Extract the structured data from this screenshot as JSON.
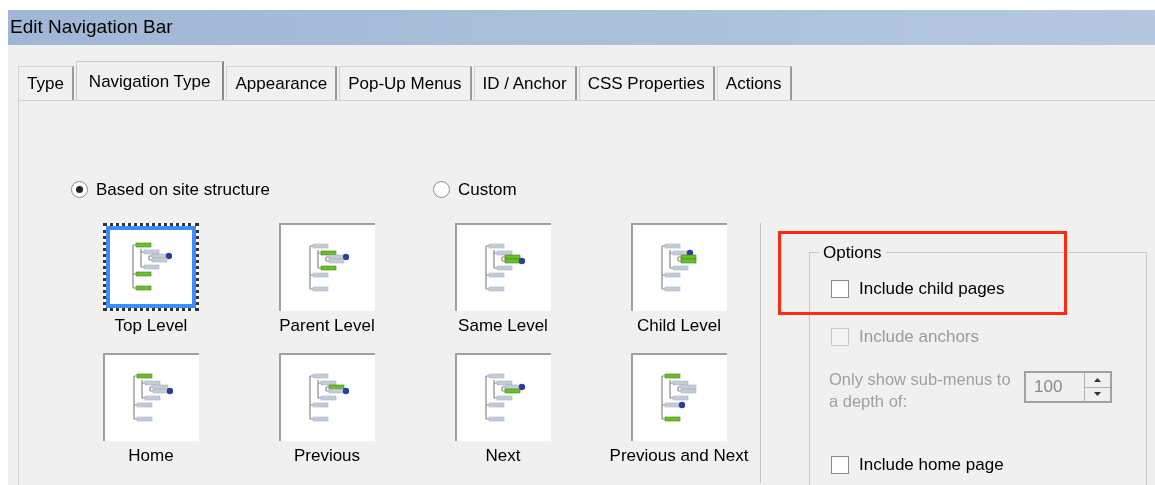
{
  "window": {
    "title": "Edit Navigation Bar"
  },
  "tabs": [
    {
      "label": "Type",
      "selected": false
    },
    {
      "label": "Navigation Type",
      "selected": true
    },
    {
      "label": "Appearance",
      "selected": false
    },
    {
      "label": "Pop-Up Menus",
      "selected": false
    },
    {
      "label": "ID / Anchor",
      "selected": false
    },
    {
      "label": "CSS Properties",
      "selected": false
    },
    {
      "label": "Actions",
      "selected": false
    }
  ],
  "source": [
    {
      "label": "Based on site structure",
      "selected": true
    },
    {
      "label": "Custom",
      "selected": false
    }
  ],
  "navigation_types": [
    {
      "label": "Top Level",
      "selected": true
    },
    {
      "label": "Parent Level",
      "selected": false
    },
    {
      "label": "Same Level",
      "selected": false
    },
    {
      "label": "Child Level",
      "selected": false
    },
    {
      "label": "Home",
      "selected": false
    },
    {
      "label": "Previous",
      "selected": false
    },
    {
      "label": "Next",
      "selected": false
    },
    {
      "label": "Previous and Next",
      "selected": false
    }
  ],
  "options": {
    "title": "Options",
    "highlighted": true,
    "checkboxes": [
      {
        "label": "Include child pages",
        "checked": false,
        "disabled": false
      },
      {
        "label": "Include anchors",
        "checked": false,
        "disabled": true
      }
    ],
    "depth": {
      "label": "Only show sub-menus to a depth of:",
      "value": "100",
      "disabled": true
    },
    "bottom_checkbox": {
      "label": "Include home page",
      "checked": false,
      "disabled": false
    }
  }
}
